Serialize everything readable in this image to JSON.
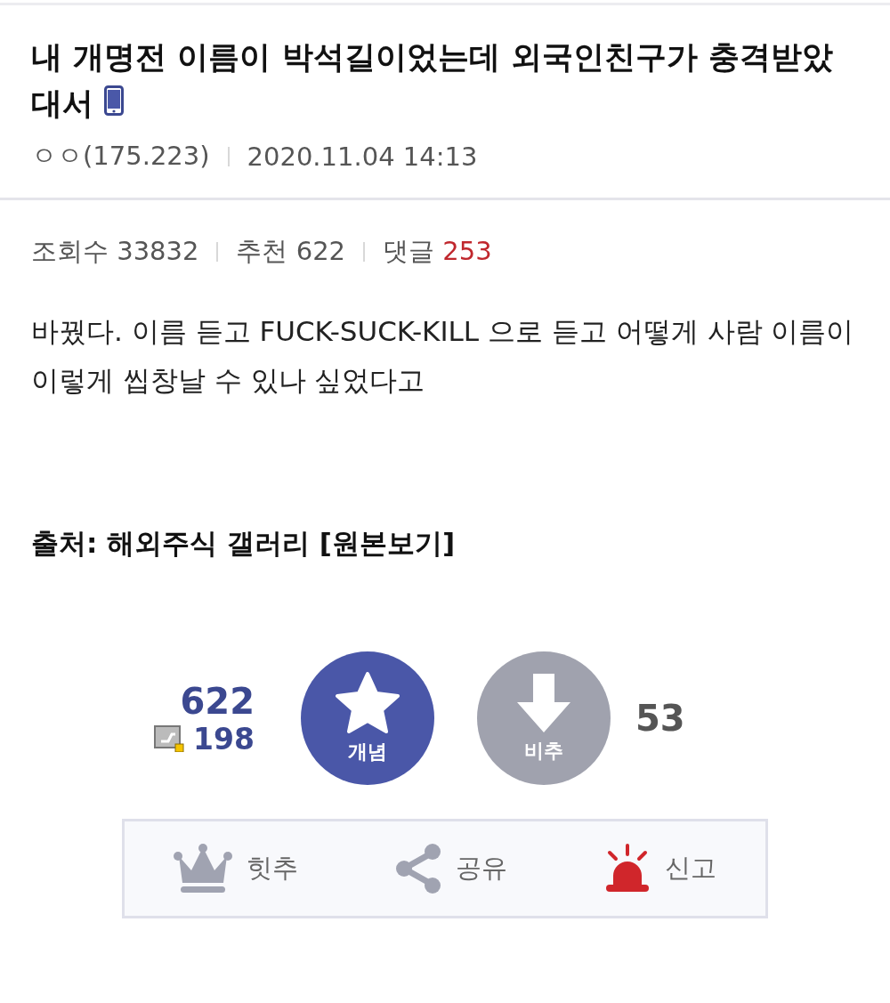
{
  "post": {
    "title": "내 개명전 이름이 박석길이었는데 외국인친구가 충격받았대서",
    "writer": "ㅇㅇ(175.223)",
    "date": "2020.11.04 14:13",
    "stats": [
      {
        "label": "조회수",
        "value": "33832",
        "kind": "plain"
      },
      {
        "label": "추천",
        "value": "622",
        "kind": "plain"
      },
      {
        "label": "댓글",
        "value": "253",
        "kind": "highlight"
      }
    ],
    "body": "바꿨다. 이름 듣고 FUCK-SUCK-KILL 으로 듣고 어떻게 사람 이름이 이렇게 씹창날 수 있나 싶었다고",
    "source": {
      "label": "출처:",
      "gallery": "해외주식 갤러리",
      "link": "[원본보기]"
    }
  },
  "vote": {
    "up_count": "622",
    "fixed_count": "198",
    "up_label": "개념",
    "down_label": "비추",
    "down_count": "53"
  },
  "actions": [
    {
      "label": "힛추",
      "kind": "crown"
    },
    {
      "label": "공유",
      "kind": "share"
    },
    {
      "label": "신고",
      "kind": "siren"
    }
  ]
}
